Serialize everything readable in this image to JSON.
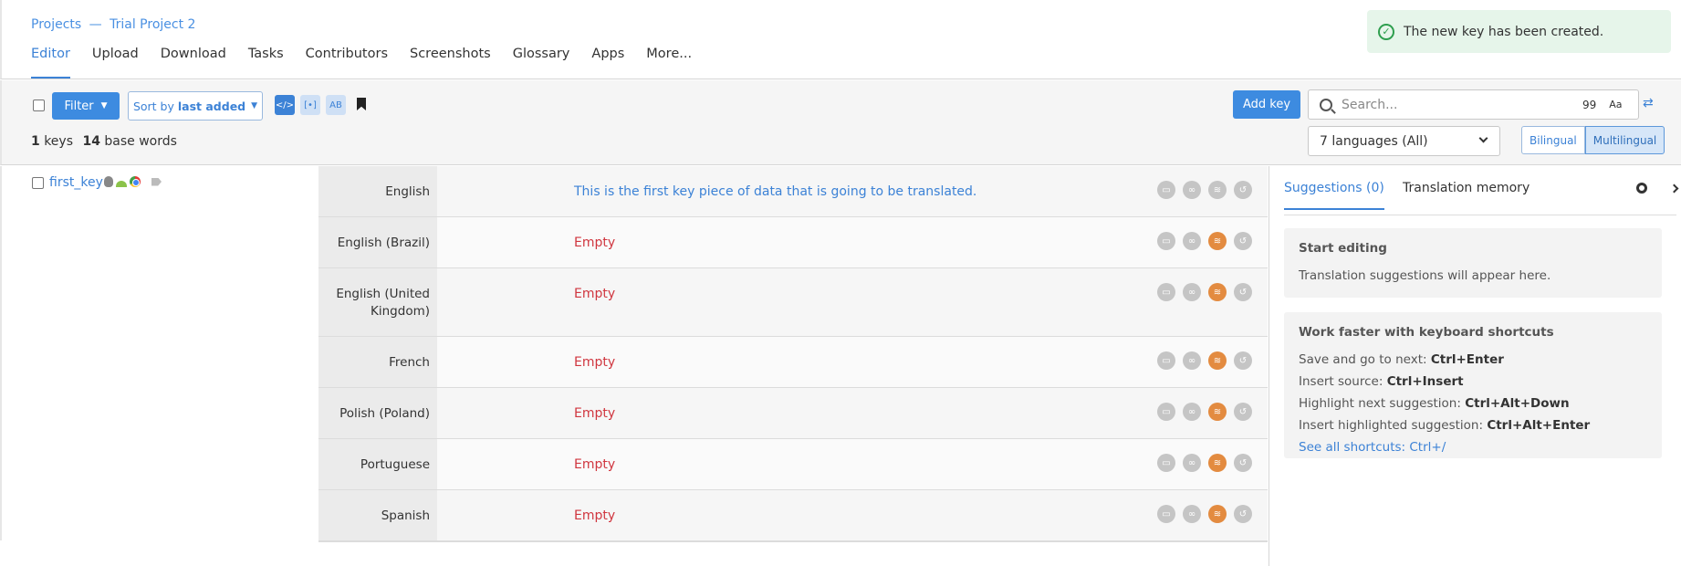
{
  "breadcrumb": {
    "projects": "Projects",
    "separator": "—",
    "project": "Trial Project 2"
  },
  "nav": {
    "tabs": [
      "Editor",
      "Upload",
      "Download",
      "Tasks",
      "Contributors",
      "Screenshots",
      "Glossary",
      "Apps",
      "More..."
    ]
  },
  "toast": {
    "message": "The new key has been created."
  },
  "toolbar": {
    "filter_label": "Filter",
    "sort_prefix": "Sort by",
    "sort_value": "last added",
    "add_key_label": "Add key",
    "search_placeholder": "Search...",
    "search_count": "99",
    "match_case": "Aa",
    "keys_count": "1",
    "keys_label": "keys",
    "words_count": "14",
    "words_label": "base words",
    "language_select": "7 languages (All)",
    "view_bilingual": "Bilingual",
    "view_multilingual": "Multilingual"
  },
  "key": {
    "name": "first_key"
  },
  "translations": [
    {
      "language": "English",
      "value": "This is the first key piece of data that is going to be translated."
    },
    {
      "language": "English (Brazil)",
      "value": "Empty"
    },
    {
      "language": "English (United Kingdom)",
      "value": "Empty"
    },
    {
      "language": "French",
      "value": "Empty"
    },
    {
      "language": "Polish (Poland)",
      "value": "Empty"
    },
    {
      "language": "Portuguese",
      "value": "Empty"
    },
    {
      "language": "Spanish",
      "value": "Empty"
    }
  ],
  "right_panel": {
    "tab_suggestions": "Suggestions (0)",
    "tab_memory": "Translation memory",
    "start_title": "Start editing",
    "start_text": "Translation suggestions will appear here.",
    "shortcuts_title": "Work faster with keyboard shortcuts",
    "shortcuts": [
      {
        "label": "Save and go to next:",
        "keys": "Ctrl+Enter"
      },
      {
        "label": "Insert source:",
        "keys": "Ctrl+Insert"
      },
      {
        "label": "Highlight next suggestion:",
        "keys": "Ctrl+Alt+Down"
      },
      {
        "label": "Insert highlighted suggestion:",
        "keys": "Ctrl+Alt+Enter"
      }
    ],
    "see_all": "See all shortcuts: Ctrl+/"
  },
  "colors": {
    "accent": "#3c82d6",
    "empty": "#d0363f",
    "toast_bg": "#e6f5ea",
    "orange": "#e38b40"
  }
}
